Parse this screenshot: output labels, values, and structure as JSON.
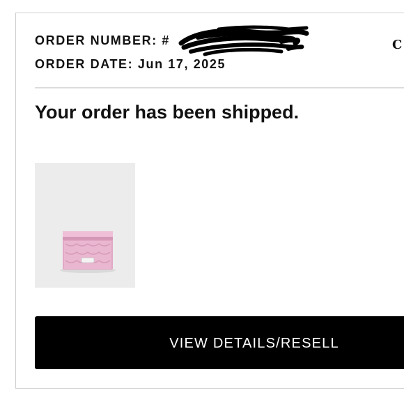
{
  "order": {
    "number_label": "ORDER NUMBER: #",
    "number_value": "",
    "date_label": "ORDER DATE:",
    "date_value": "Jun 17, 2025"
  },
  "header": {
    "brand_glyph": "C"
  },
  "main": {
    "headline": "Your order has been shipped.",
    "product": {
      "image_icon": "pink-card-case-product-image",
      "color": "#e8b4cf"
    },
    "cta_label": "VIEW DETAILS/RESELL"
  }
}
